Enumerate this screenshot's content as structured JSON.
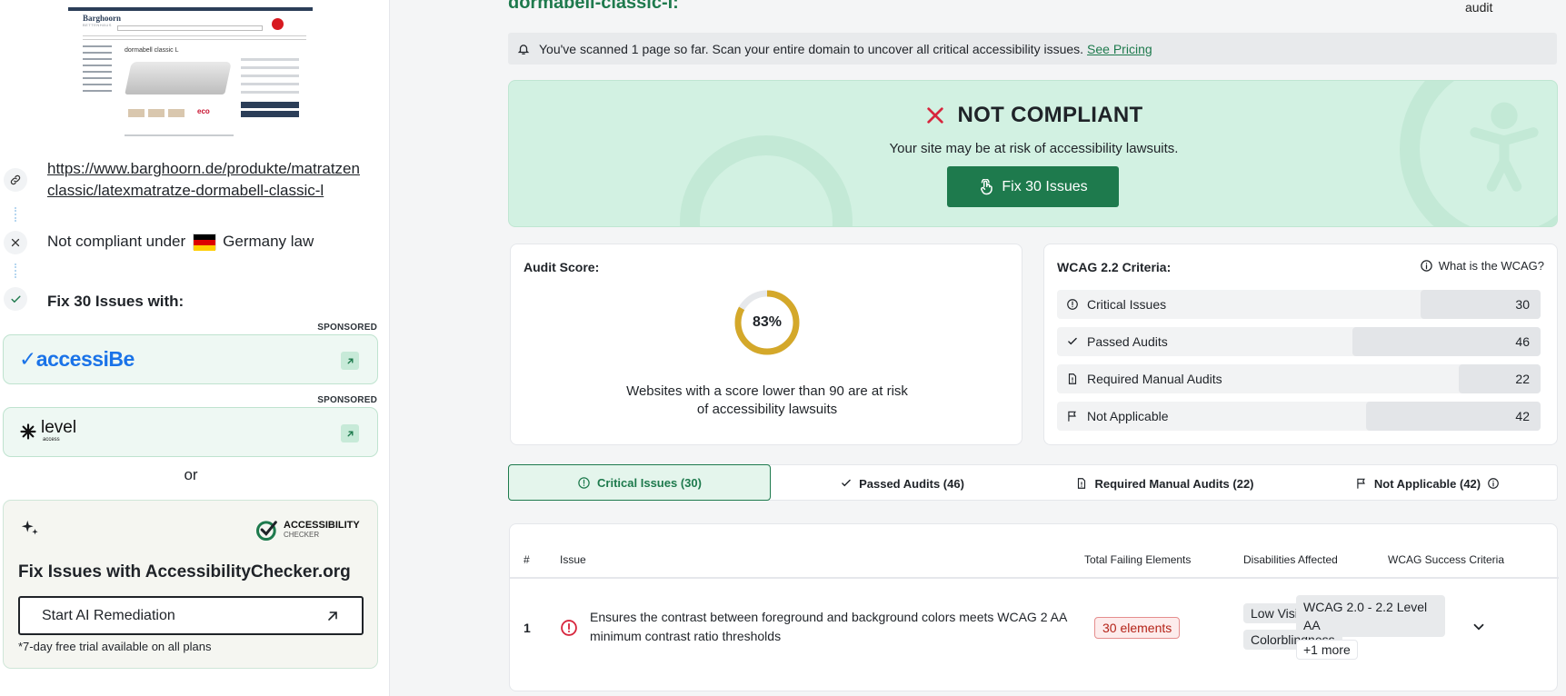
{
  "sidebar": {
    "url_line1": "https://www.barghoorn.de/produkte/matratzen",
    "url_line2": "classic/latexmatratze-dormabell-classic-l",
    "compliance_prefix": "Not compliant under",
    "law_label": "Germany law",
    "fix_with": "Fix 30 Issues with:",
    "sponsored": "SPONSORED",
    "sponsor1_name": "accessiBe",
    "sponsor2_name": "level",
    "sponsor2_sub": "access",
    "or": "or",
    "ac_logo_line1": "ACCESSIBILITY",
    "ac_logo_line2": "CHECKER",
    "ac_title": "Fix Issues with AccessibilityChecker.org",
    "ac_button": "Start AI Remediation",
    "ac_note": "*7-day free trial available on all plans",
    "thumbnail": {
      "brand": "Barghoorn",
      "brand_sub": "BETTENHAUS",
      "product_title": "dormabell classic L",
      "eco": "eco"
    }
  },
  "main": {
    "page_title": "dormabell-classic-l:",
    "top_right": "audit",
    "notice_text": "You've scanned 1 page so far. Scan your entire domain to uncover all critical accessibility issues.",
    "notice_link": "See Pricing",
    "status_title": "NOT COMPLIANT",
    "status_sub": "Your site may be at risk of accessibility lawsuits.",
    "fix_button": "Fix 30 Issues",
    "audit_score_title": "Audit Score:",
    "audit_score_value": "83%",
    "audit_score_fraction": 0.83,
    "score_note_line1": "Websites with a score lower than 90 are at risk",
    "score_note_line2": "of accessibility lawsuits",
    "wcag_title": "WCAG 2.2 Criteria:",
    "wcag_help": "What is the WCAG?",
    "criteria": [
      {
        "label": "Critical Issues",
        "count": "30",
        "icon": "alert-circle-icon"
      },
      {
        "label": "Passed Audits",
        "count": "46",
        "icon": "check-icon"
      },
      {
        "label": "Required Manual Audits",
        "count": "22",
        "icon": "document-icon"
      },
      {
        "label": "Not Applicable",
        "count": "42",
        "icon": "flag-icon"
      }
    ],
    "tabs": [
      {
        "label": "Critical Issues (30)",
        "icon": "alert-circle-icon"
      },
      {
        "label": "Passed Audits (46)",
        "icon": "check-icon"
      },
      {
        "label": "Required Manual Audits (22)",
        "icon": "document-icon"
      },
      {
        "label": "Not Applicable (42)",
        "icon": "flag-icon"
      }
    ],
    "table": {
      "headers": [
        "#",
        "Issue",
        "Total Failing Elements",
        "Disabilities Affected",
        "WCAG Success Criteria"
      ],
      "rows": [
        {
          "num": "1",
          "issue": "Ensures the contrast between foreground and background colors meets WCAG 2 AA minimum contrast ratio thresholds",
          "failing": "30 elements",
          "disabilities": [
            "Low Vision",
            "Colorblindness"
          ],
          "wcag": "WCAG 2.0 - 2.2 Level AA",
          "more": "+1 more"
        }
      ]
    }
  },
  "colors": {
    "brand_green": "#1e7a4d",
    "banner_bg": "#d2f1e2",
    "fail_red": "#d7263d",
    "donut_gold": "#d4a82a"
  }
}
